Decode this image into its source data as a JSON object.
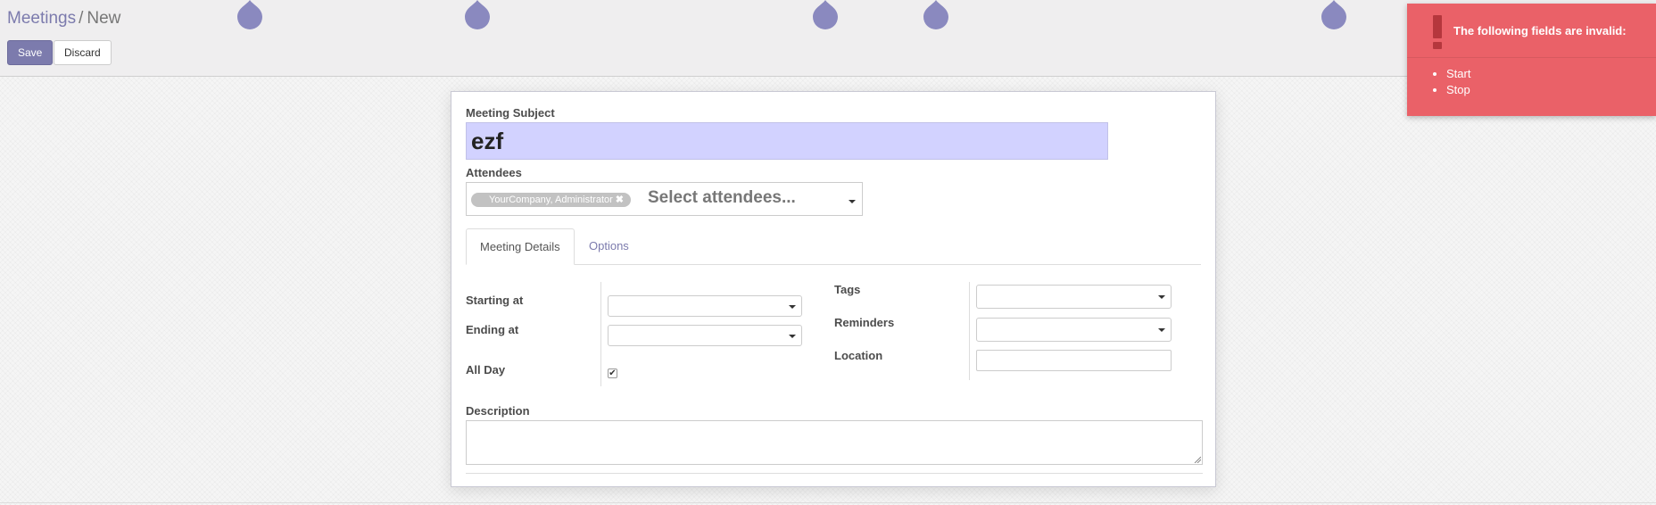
{
  "breadcrumb": {
    "parent": "Meetings",
    "separator": "/",
    "current": "New"
  },
  "buttons": {
    "save": "Save",
    "discard": "Discard"
  },
  "form": {
    "subject_label": "Meeting Subject",
    "subject_value": "ezf",
    "attendees_label": "Attendees",
    "attendee_tags": [
      {
        "label": "YourCompany, Administrator",
        "remove_icon": "close-icon"
      }
    ],
    "attendees_placeholder": "Select attendees...",
    "tabs": [
      {
        "label": "Meeting Details",
        "active": true
      },
      {
        "label": "Options",
        "active": false
      }
    ],
    "starting_at_label": "Starting at",
    "starting_at_value": "",
    "ending_at_label": "Ending at",
    "ending_at_value": "",
    "all_day_label": "All Day",
    "all_day_checked": true,
    "tags_label": "Tags",
    "tags_value": "",
    "reminders_label": "Reminders",
    "reminders_value": "",
    "location_label": "Location",
    "location_value": "",
    "description_label": "Description",
    "description_value": ""
  },
  "notification": {
    "icon": "exclamation-icon",
    "title": "The following fields are invalid:",
    "items": [
      "Start",
      "Stop"
    ]
  },
  "colors": {
    "primary": "#7c7bad",
    "highlight_input": "#d2d2ff",
    "danger": "#ea6168"
  }
}
